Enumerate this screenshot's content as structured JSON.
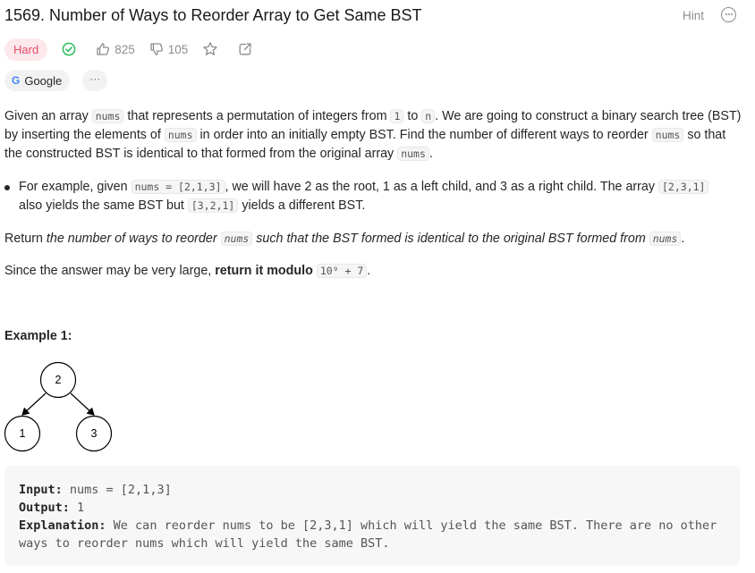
{
  "problem": {
    "title": "1569. Number of Ways to Reorder Array to Get Same BST",
    "hint_label": "Hint",
    "difficulty": "Hard",
    "likes": "825",
    "dislikes": "105",
    "company_tag": "Google",
    "more_tags": "···"
  },
  "description": {
    "p1_a": "Given an array ",
    "code_nums": "nums",
    "p1_b": " that represents a permutation of integers from ",
    "code_1": "1",
    "p1_c": " to ",
    "code_n": "n",
    "p1_d": ". We are going to construct a binary search tree (BST) by inserting the elements of ",
    "p1_e": " in order into an initially empty BST. Find the number of different ways to reorder ",
    "p1_f": " so that the constructed BST is identical to that formed from the original array ",
    "p1_g": ".",
    "b1_a": "For example, given ",
    "b1_code1": "nums = [2,1,3]",
    "b1_b": ", we will have 2 as the root, 1 as a left child, and 3 as a right child. The array ",
    "b1_code2": "[2,3,1]",
    "b1_c": " also yields the same BST but ",
    "b1_code3": "[3,2,1]",
    "b1_d": " yields a different BST.",
    "p2_a": "Return ",
    "p2_em1": "the number of ways to reorder ",
    "p2_em2": " such that the BST formed is identical to the original BST formed from ",
    "p2_end": ".",
    "p3_a": "Since the answer may be very large, ",
    "p3_b": "return it modulo",
    "p3_code": "10⁹ + 7",
    "p3_end": "."
  },
  "example1": {
    "title": "Example 1:",
    "tree": {
      "root": "2",
      "left": "1",
      "right": "3"
    },
    "input_label": "Input:",
    "input_value": " nums = [2,1,3]",
    "output_label": "Output:",
    "output_value": " 1",
    "explanation_label": "Explanation:",
    "explanation_value": " We can reorder nums to be [2,3,1] which will yield the same BST. There are no other ways to reorder nums which will yield the same BST."
  }
}
